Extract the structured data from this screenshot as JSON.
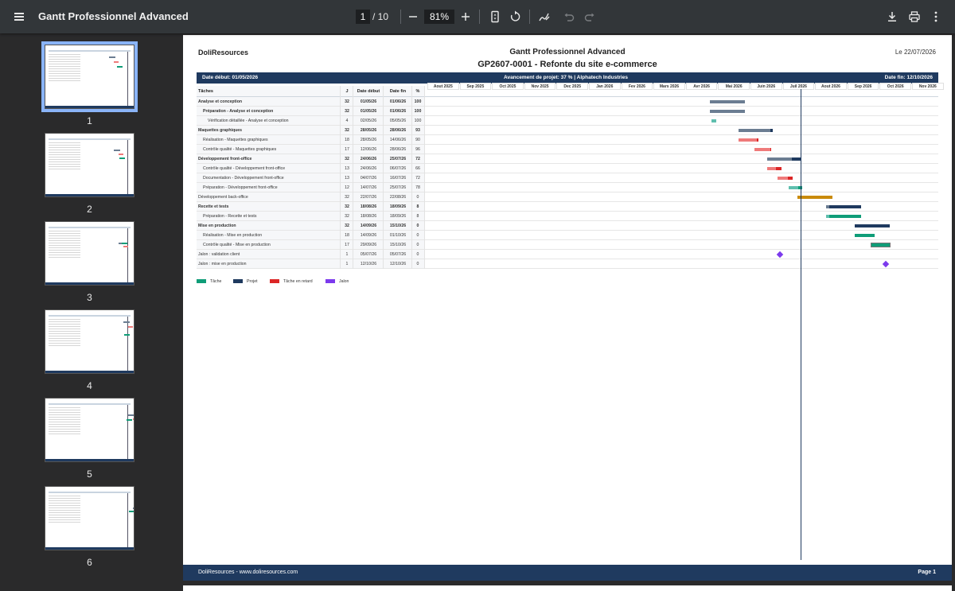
{
  "toolbar": {
    "title": "Gantt Professionnel Advanced",
    "page_current": "1",
    "page_total": "/ 10",
    "zoom": "81%",
    "icons": [
      "menu-icon",
      "zoom-out-icon",
      "zoom-in-icon",
      "fit-page-icon",
      "rotate-icon",
      "annotate-icon",
      "undo-icon",
      "redo-icon",
      "download-icon",
      "print-icon",
      "more-icon"
    ]
  },
  "sidebar": {
    "thumbnails": [
      {
        "label": "1",
        "active": true
      },
      {
        "label": "2",
        "active": false
      },
      {
        "label": "3",
        "active": false
      },
      {
        "label": "4",
        "active": false
      },
      {
        "label": "5",
        "active": false
      },
      {
        "label": "6",
        "active": false
      }
    ]
  },
  "document": {
    "brand": "DoliResources",
    "title": "Gantt Professionnel Advanced",
    "date": "Le 22/07/2026",
    "subtitle": "GP2607-0001 - Refonte du site e-commerce",
    "info_start": "Date début: 01/05/2026",
    "info_progress": "Avancement de projet: 37 %  |  Alphatech Industries",
    "info_end": "Date fin: 12/10/2026",
    "columns": {
      "task": "Tâches",
      "days": "J",
      "start": "Date début",
      "end": "Date fin",
      "pct": "%"
    },
    "months": [
      "Aout 2025",
      "Sep 2025",
      "Oct 2025",
      "Nov 2025",
      "Dec 2025",
      "Jan 2026",
      "Fev 2026",
      "Mars 2026",
      "Avr 2026",
      "Mai 2026",
      "Juin 2026",
      "Juil 2026",
      "Aout 2026",
      "Sep 2026",
      "Oct 2026",
      "Nov 2026"
    ],
    "tasks": [
      {
        "name": "Analyse et conception",
        "days": "32",
        "start": "01/05/26",
        "end": "01/06/26",
        "pct": "100",
        "level": 0,
        "bold": true
      },
      {
        "name": "Préparation - Analyse et conception",
        "days": "32",
        "start": "01/05/26",
        "end": "01/06/26",
        "pct": "100",
        "level": 1,
        "bold": true
      },
      {
        "name": "Vérification détaillée - Analyse et conception",
        "days": "4",
        "start": "02/05/26",
        "end": "05/05/26",
        "pct": "100",
        "level": 2,
        "bold": false
      },
      {
        "name": "Maquettes graphiques",
        "days": "32",
        "start": "28/05/26",
        "end": "28/06/26",
        "pct": "93",
        "level": 0,
        "bold": true
      },
      {
        "name": "Réalisation - Maquettes graphiques",
        "days": "18",
        "start": "28/05/26",
        "end": "14/06/26",
        "pct": "90",
        "level": 1,
        "bold": false
      },
      {
        "name": "Contrôle qualité - Maquettes graphiques",
        "days": "17",
        "start": "12/06/26",
        "end": "28/06/26",
        "pct": "96",
        "level": 1,
        "bold": false
      },
      {
        "name": "Développement front-office",
        "days": "32",
        "start": "24/06/26",
        "end": "25/07/26",
        "pct": "72",
        "level": 0,
        "bold": true
      },
      {
        "name": "Contrôle qualité - Développement front-office",
        "days": "13",
        "start": "24/06/26",
        "end": "06/07/26",
        "pct": "66",
        "level": 1,
        "bold": false
      },
      {
        "name": "Documentation - Développement front-office",
        "days": "13",
        "start": "04/07/26",
        "end": "16/07/26",
        "pct": "72",
        "level": 1,
        "bold": false
      },
      {
        "name": "Préparation - Développement front-office",
        "days": "12",
        "start": "14/07/26",
        "end": "25/07/26",
        "pct": "78",
        "level": 1,
        "bold": false
      },
      {
        "name": "Développement back-office",
        "days": "32",
        "start": "22/07/26",
        "end": "22/08/26",
        "pct": "0",
        "level": 0,
        "bold": false
      },
      {
        "name": "Recette et tests",
        "days": "32",
        "start": "18/08/26",
        "end": "18/09/26",
        "pct": "8",
        "level": 0,
        "bold": true
      },
      {
        "name": "Préparation - Recette et tests",
        "days": "32",
        "start": "18/08/26",
        "end": "18/09/26",
        "pct": "8",
        "level": 1,
        "bold": false
      },
      {
        "name": "Mise en production",
        "days": "32",
        "start": "14/09/26",
        "end": "15/10/26",
        "pct": "0",
        "level": 0,
        "bold": true
      },
      {
        "name": "Réalisation - Mise en production",
        "days": "18",
        "start": "14/09/26",
        "end": "01/10/26",
        "pct": "0",
        "level": 1,
        "bold": false
      },
      {
        "name": "Contrôle qualité - Mise en production",
        "days": "17",
        "start": "29/09/26",
        "end": "15/10/26",
        "pct": "0",
        "level": 1,
        "bold": false
      },
      {
        "name": "Jalon : validation client",
        "days": "1",
        "start": "05/07/26",
        "end": "05/07/26",
        "pct": "0",
        "level": 0,
        "bold": false
      },
      {
        "name": "Jalon : mise en production",
        "days": "1",
        "start": "12/10/26",
        "end": "12/10/26",
        "pct": "0",
        "level": 0,
        "bold": false
      }
    ],
    "legend": [
      {
        "label": "Tâche",
        "color": "#0f9d78"
      },
      {
        "label": "Projet",
        "color": "#1f3a5f"
      },
      {
        "label": "Tâche en retard",
        "color": "#dc2626"
      },
      {
        "label": "Jalon",
        "color": "#7c3aed"
      }
    ],
    "footer_left": "DoliResources - www.doliresources.com",
    "footer_right": "Page 1"
  },
  "colors": {
    "project": "#1f3a5f",
    "project_done": "#6b7d92",
    "task": "#0f9d78",
    "task_done": "#5fbfae",
    "late": "#dc2626",
    "late_done": "#ef7a7a",
    "backoffice": "#c98a0a",
    "milestone": "#7c3aed"
  }
}
